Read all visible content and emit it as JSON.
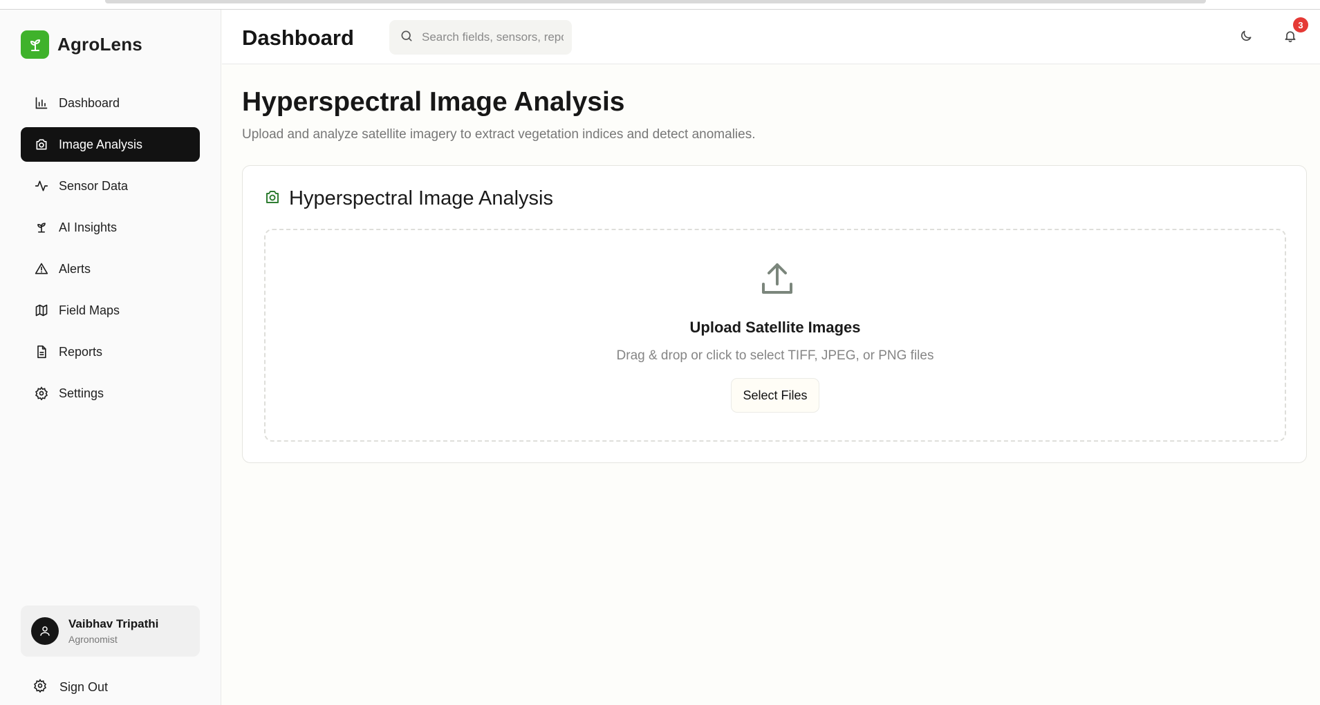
{
  "brand": {
    "name": "AgroLens",
    "accent": "#3fb22b"
  },
  "sidebar": {
    "items": [
      {
        "label": "Dashboard",
        "icon": "bar-chart-icon"
      },
      {
        "label": "Image Analysis",
        "icon": "camera-icon",
        "active": true
      },
      {
        "label": "Sensor Data",
        "icon": "activity-icon"
      },
      {
        "label": "AI Insights",
        "icon": "sprout-icon"
      },
      {
        "label": "Alerts",
        "icon": "warning-icon"
      },
      {
        "label": "Field Maps",
        "icon": "map-icon"
      },
      {
        "label": "Reports",
        "icon": "file-text-icon"
      },
      {
        "label": "Settings",
        "icon": "gear-icon"
      }
    ],
    "user": {
      "name": "Vaibhav Tripathi",
      "role": "Agronomist"
    },
    "sign_out_label": "Sign Out"
  },
  "header": {
    "title": "Dashboard",
    "search_placeholder": "Search fields, sensors, reports...",
    "notification_count": "3",
    "badge_color": "#e53935"
  },
  "main": {
    "title": "Hyperspectral Image Analysis",
    "subtitle": "Upload and analyze satellite imagery to extract vegetation indices and detect anomalies.",
    "card": {
      "title": "Hyperspectral Image Analysis",
      "upload_title": "Upload Satellite Images",
      "upload_hint": "Drag & drop or click to select TIFF, JPEG, or PNG files",
      "button_label": "Select Files"
    }
  }
}
